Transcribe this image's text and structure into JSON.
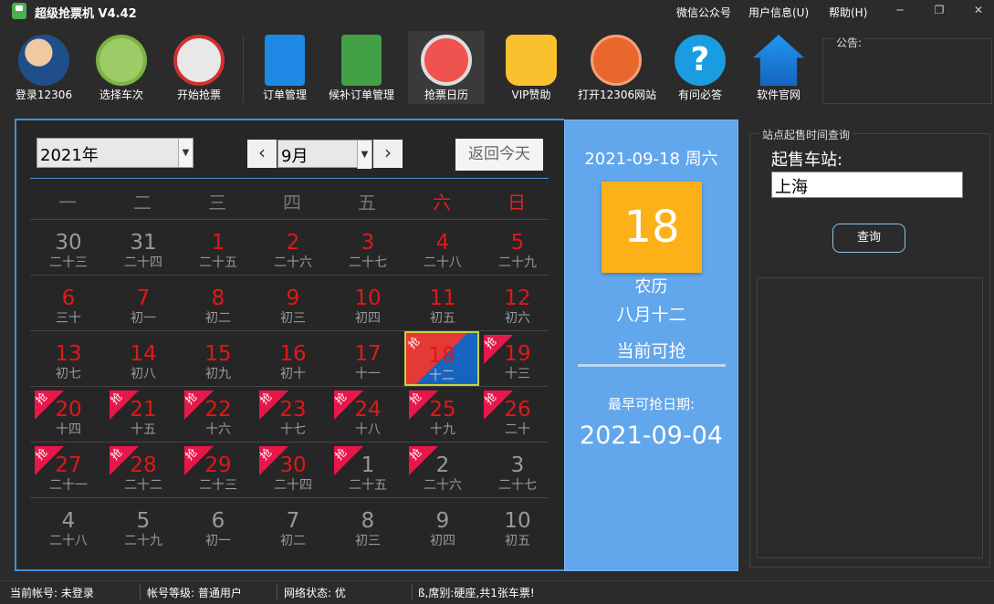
{
  "titlebar": {
    "title": "超级抢票机 V4.42",
    "menus": [
      "微信公众号",
      "用户信息(U)",
      "帮助(H)"
    ],
    "window_controls": [
      "minimize-icon",
      "restore-icon",
      "close-icon"
    ]
  },
  "toolbar": {
    "items": [
      {
        "label": "登录12306",
        "icon": "user-login-icon"
      },
      {
        "label": "选择车次",
        "icon": "train-icon"
      },
      {
        "label": "开始抢票",
        "icon": "ticket-grab-icon"
      },
      {
        "label": "订单管理",
        "icon": "order-list-icon"
      },
      {
        "label": "候补订单管理",
        "icon": "waitlist-order-icon"
      },
      {
        "label": "抢票日历",
        "icon": "stopwatch-icon"
      },
      {
        "label": "VIP赞助",
        "icon": "vip-crown-icon"
      },
      {
        "label": "打开12306网站",
        "icon": "railway-logo-icon"
      },
      {
        "label": "有问必答",
        "icon": "help-question-icon"
      },
      {
        "label": "软件官网",
        "icon": "home-icon"
      }
    ],
    "notice_label": "公告:"
  },
  "calendar": {
    "year": "2021年",
    "month": "9月",
    "today_button": "返回今天",
    "weekdays": [
      "一",
      "二",
      "三",
      "四",
      "五",
      "六",
      "日"
    ],
    "badge_text": "抢",
    "rows": [
      [
        {
          "d": "30",
          "l": "二十三"
        },
        {
          "d": "31",
          "l": "二十四"
        },
        {
          "d": "1",
          "l": "二十五",
          "r": true
        },
        {
          "d": "2",
          "l": "二十六",
          "r": true
        },
        {
          "d": "3",
          "l": "二十七",
          "r": true
        },
        {
          "d": "4",
          "l": "二十八",
          "r": true
        },
        {
          "d": "5",
          "l": "二十九",
          "r": true
        }
      ],
      [
        {
          "d": "6",
          "l": "三十",
          "r": true
        },
        {
          "d": "7",
          "l": "初一",
          "r": true
        },
        {
          "d": "8",
          "l": "初二",
          "r": true
        },
        {
          "d": "9",
          "l": "初三",
          "r": true
        },
        {
          "d": "10",
          "l": "初四",
          "r": true
        },
        {
          "d": "11",
          "l": "初五",
          "r": true
        },
        {
          "d": "12",
          "l": "初六",
          "r": true
        }
      ],
      [
        {
          "d": "13",
          "l": "初七",
          "r": true
        },
        {
          "d": "14",
          "l": "初八",
          "r": true
        },
        {
          "d": "15",
          "l": "初九",
          "r": true
        },
        {
          "d": "16",
          "l": "初十",
          "r": true
        },
        {
          "d": "17",
          "l": "十一",
          "r": true
        },
        {
          "d": "18",
          "l": "十二",
          "r": true,
          "b": true,
          "s": true
        },
        {
          "d": "19",
          "l": "十三",
          "r": true,
          "b": true
        }
      ],
      [
        {
          "d": "20",
          "l": "十四",
          "r": true,
          "b": true
        },
        {
          "d": "21",
          "l": "十五",
          "r": true,
          "b": true
        },
        {
          "d": "22",
          "l": "十六",
          "r": true,
          "b": true
        },
        {
          "d": "23",
          "l": "十七",
          "r": true,
          "b": true
        },
        {
          "d": "24",
          "l": "十八",
          "r": true,
          "b": true
        },
        {
          "d": "25",
          "l": "十九",
          "r": true,
          "b": true
        },
        {
          "d": "26",
          "l": "二十",
          "r": true,
          "b": true
        }
      ],
      [
        {
          "d": "27",
          "l": "二十一",
          "r": true,
          "b": true
        },
        {
          "d": "28",
          "l": "二十二",
          "r": true,
          "b": true
        },
        {
          "d": "29",
          "l": "二十三",
          "r": true,
          "b": true
        },
        {
          "d": "30",
          "l": "二十四",
          "r": true,
          "b": true
        },
        {
          "d": "1",
          "l": "二十五",
          "b": true
        },
        {
          "d": "2",
          "l": "二十六",
          "b": true
        },
        {
          "d": "3",
          "l": "二十七"
        }
      ],
      [
        {
          "d": "4",
          "l": "二十八"
        },
        {
          "d": "5",
          "l": "二十九"
        },
        {
          "d": "6",
          "l": "初一"
        },
        {
          "d": "7",
          "l": "初二"
        },
        {
          "d": "8",
          "l": "初三"
        },
        {
          "d": "9",
          "l": "初四"
        },
        {
          "d": "10",
          "l": "初五"
        }
      ]
    ]
  },
  "info": {
    "date": "2021-09-18 周六",
    "day": "18",
    "lunar_label": "农历",
    "lunar_day": "八月十二",
    "status": "当前可抢",
    "earliest_label": "最早可抢日期:",
    "earliest_date": "2021-09-04"
  },
  "query": {
    "group_title": "站点起售时间查询",
    "station_label": "起售车站:",
    "station_value": "上海",
    "button": "查询"
  },
  "status": {
    "account": "当前帐号: 未登录",
    "level": "帐号等级: 普通用户",
    "network": "网络状态: 优",
    "message": "ß,席别:硬座,共1张车票!"
  },
  "colors": {
    "accent_blue": "#62a6ec",
    "day_box": "#fbb117",
    "holiday_red": "#e01818",
    "badge_red": "#e8174a"
  }
}
